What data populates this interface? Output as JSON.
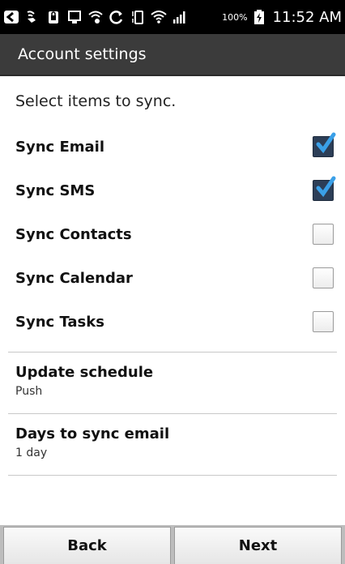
{
  "status_bar": {
    "battery_percent": "100%",
    "time": "11:52 AM",
    "icons": [
      "back-arrow-icon",
      "wifi-call-icon",
      "lock-phone-icon",
      "monitor-icon",
      "wifi-hotspot-icon",
      "sync-icon",
      "vibrate-icon",
      "wifi-icon",
      "signal-icon",
      "battery-icon"
    ]
  },
  "title_bar": {
    "title": "Account settings"
  },
  "sync_section": {
    "header": "Select items to sync.",
    "items": [
      {
        "label": "Sync Email",
        "checked": true
      },
      {
        "label": "Sync SMS",
        "checked": true
      },
      {
        "label": "Sync Contacts",
        "checked": false
      },
      {
        "label": "Sync Calendar",
        "checked": false
      },
      {
        "label": "Sync Tasks",
        "checked": false
      }
    ]
  },
  "settings": [
    {
      "title": "Update schedule",
      "value": "Push"
    },
    {
      "title": "Days to sync email",
      "value": "1 day"
    }
  ],
  "buttons": {
    "back": "Back",
    "next": "Next"
  },
  "colors": {
    "checkbox_checked_bg": "#2c3e57",
    "check_mark": "#3aa0e8",
    "title_bar_bg": "#3b3b3b"
  }
}
